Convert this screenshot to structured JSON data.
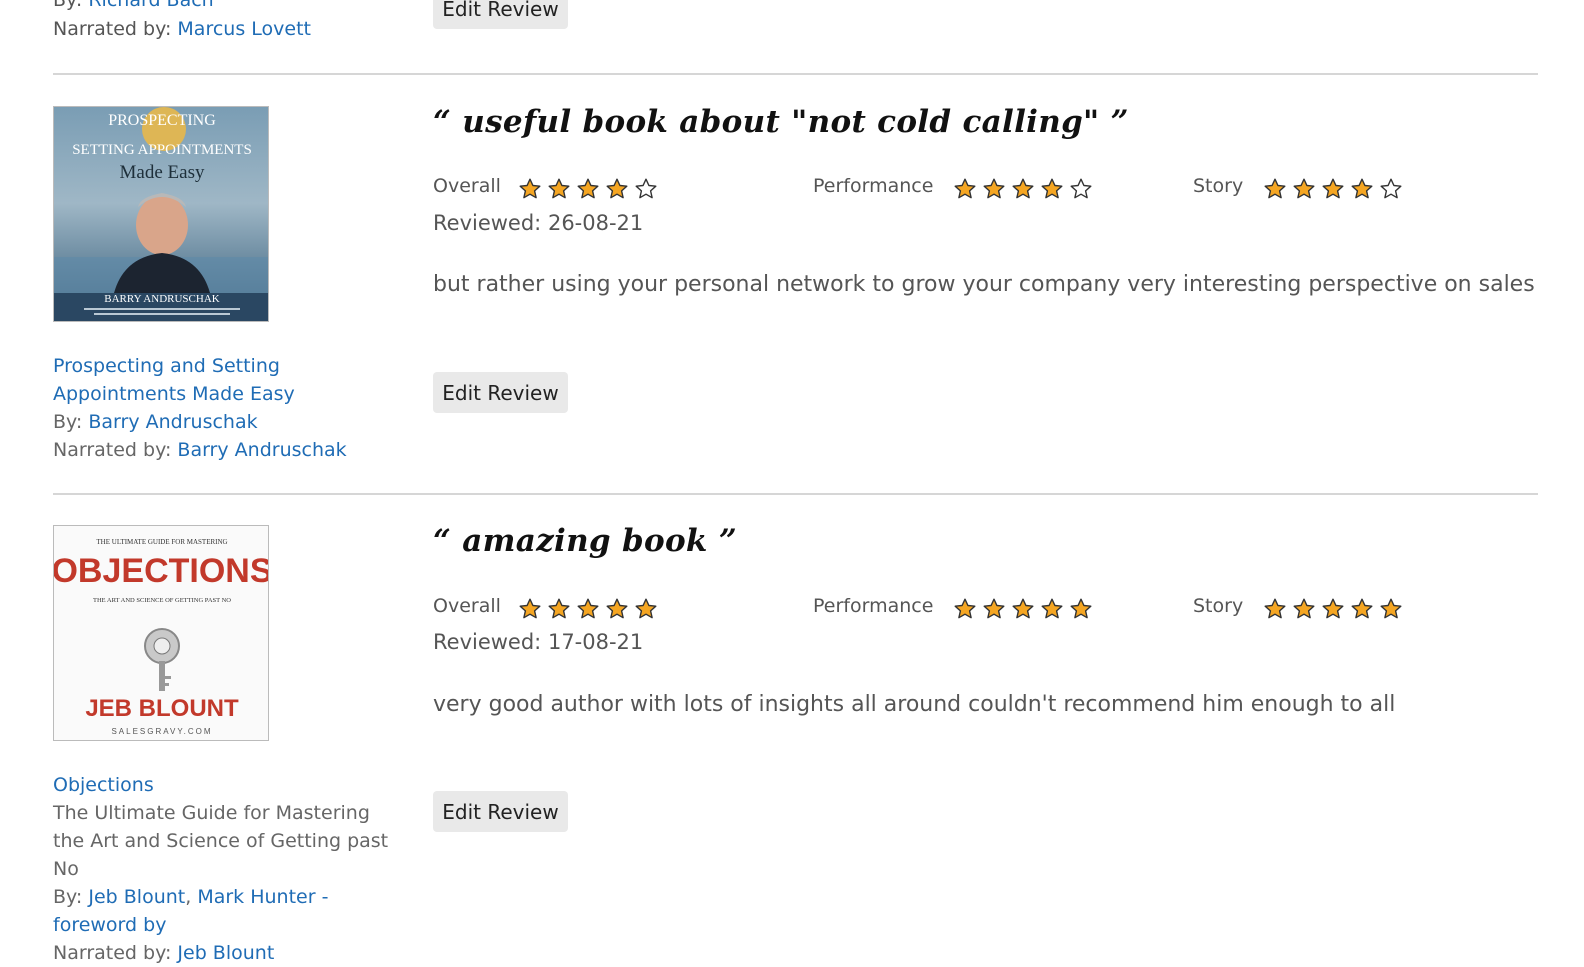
{
  "previous": {
    "by_prefix": "By:",
    "author": "Richard Bach",
    "narrated_prefix": "Narrated by:",
    "narrator": "Marcus Lovett",
    "edit_label": "Edit Review"
  },
  "rating_labels": {
    "overall": "Overall",
    "performance": "Performance",
    "story": "Story"
  },
  "colors": {
    "link": "#1f6cb5",
    "star_fill": "#f5a623",
    "star_stroke": "#333333",
    "separator": "#d6d6d6"
  },
  "reviews": [
    {
      "title_open": "“",
      "title": "useful book about \"not cold calling\"",
      "title_close": "”",
      "ratings": {
        "overall": 4,
        "performance": 4,
        "story": 4
      },
      "reviewed_label": "Reviewed:",
      "reviewed_date": "26-08-21",
      "body": "but rather using your personal network to grow your company very interesting perspective on sales",
      "edit_label": "Edit Review",
      "book": {
        "title": "Prospecting and Setting Appointments Made Easy",
        "subtitle": "",
        "by_prefix": "By:",
        "authors": [
          "Barry Andruschak"
        ],
        "narrated_prefix": "Narrated by:",
        "narrator": "Barry Andruschak",
        "cover": {
          "line1": "PROSPECTING",
          "line2": "SETTING APPOINTMENTS",
          "line3": "Made Easy",
          "author": "BARRY ANDRUSCHAK"
        }
      }
    },
    {
      "title_open": "“",
      "title": "amazing book",
      "title_close": "”",
      "ratings": {
        "overall": 5,
        "performance": 5,
        "story": 5
      },
      "reviewed_label": "Reviewed:",
      "reviewed_date": "17-08-21",
      "body": "very good author with lots of insights all around couldn't recommend him enough to all",
      "edit_label": "Edit Review",
      "book": {
        "title": "Objections",
        "subtitle": "The Ultimate Guide for Mastering the Art and Science of Getting past No",
        "by_prefix": "By:",
        "authors": [
          "Jeb Blount",
          "Mark Hunter - foreword by"
        ],
        "author_separator": ",",
        "narrated_prefix": "Narrated by:",
        "narrator": "Jeb Blount",
        "cover": {
          "top": "THE ULTIMATE GUIDE FOR MASTERING",
          "title": "OBJECTIONS",
          "sub": "THE ART AND SCIENCE OF GETTING PAST NO",
          "author": "JEB BLOUNT",
          "site": "SALESGRAVY.COM"
        }
      }
    }
  ]
}
